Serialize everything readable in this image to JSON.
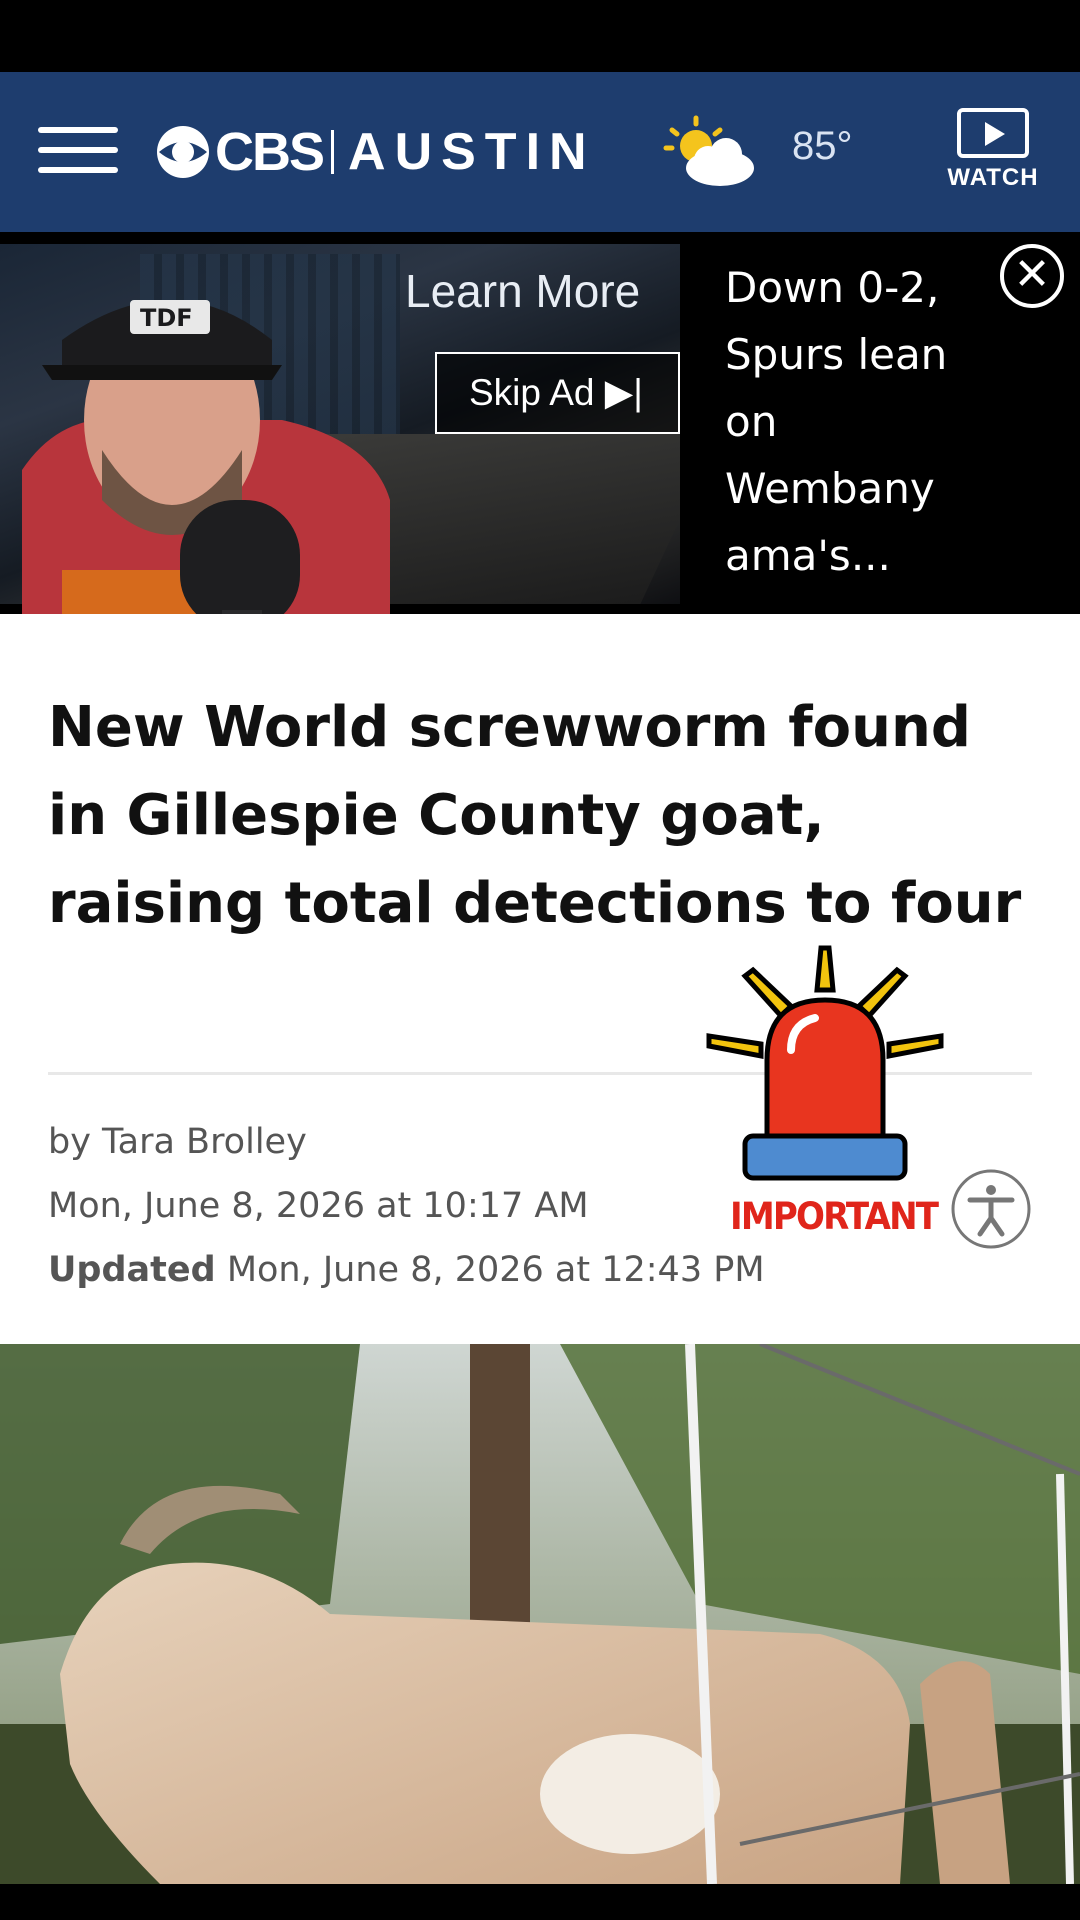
{
  "header": {
    "brand_cbs": "CBS",
    "brand_city": "AUSTIN",
    "temperature": "85°",
    "weather_icon": "partly-sunny-icon",
    "watch_label": "WATCH",
    "bg_color": "#1e3d6e"
  },
  "ad": {
    "learn_more": "Learn More",
    "skip_ad": "Skip Ad ▶|",
    "headline": "Down 0-2, Spurs lean on Wembany ama's...",
    "close_icon": "close-circle-icon"
  },
  "article": {
    "headline": "New World screwworm found in Gillespie County goat, raising total detections to four",
    "byline": "by Tara Brolley",
    "published": "Mon, June 8, 2026 at 10:17 AM",
    "updated_label": "Updated",
    "updated": "Mon, June 8, 2026 at 12:43 PM"
  },
  "overlay": {
    "important_label": "IMPORTANT",
    "alert_color": "#e0251b"
  }
}
